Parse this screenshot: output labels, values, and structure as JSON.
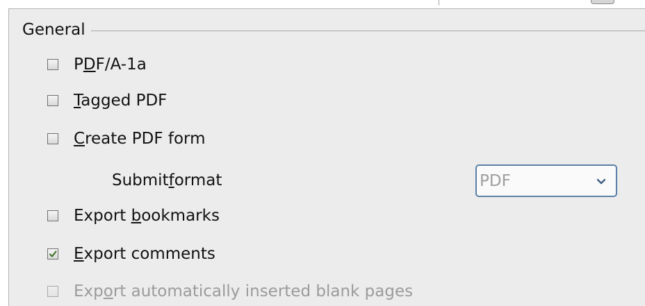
{
  "section": {
    "title": "General"
  },
  "options": [
    {
      "label_pre": "P",
      "label_key": "D",
      "label_post": "F/A-1a",
      "checked": false,
      "enabled": true
    },
    {
      "label_pre": "",
      "label_key": "T",
      "label_post": "agged PDF",
      "checked": false,
      "enabled": true
    },
    {
      "label_pre": "",
      "label_key": "C",
      "label_post": "reate PDF form",
      "checked": false,
      "enabled": true
    },
    {
      "label_pre": "Export ",
      "label_key": "b",
      "label_post": "ookmarks",
      "checked": false,
      "enabled": true
    },
    {
      "label_pre": "",
      "label_key": "E",
      "label_post": "xport comments",
      "checked": true,
      "enabled": true
    },
    {
      "label_pre": "Exp",
      "label_key": "o",
      "label_post": "rt automatically inserted blank pages",
      "checked": false,
      "enabled": false
    }
  ],
  "submit_format": {
    "label_pre": "Submit ",
    "label_key": "f",
    "label_post": "ormat",
    "selected_value": "PDF",
    "enabled": false
  },
  "icons": {
    "check": "checkmark-icon",
    "dropdown": "chevron-down-icon"
  },
  "colors": {
    "check_mark": "#3b6e22",
    "combo_border": "#5b7fa6",
    "disabled_text": "#9b9b9b"
  }
}
